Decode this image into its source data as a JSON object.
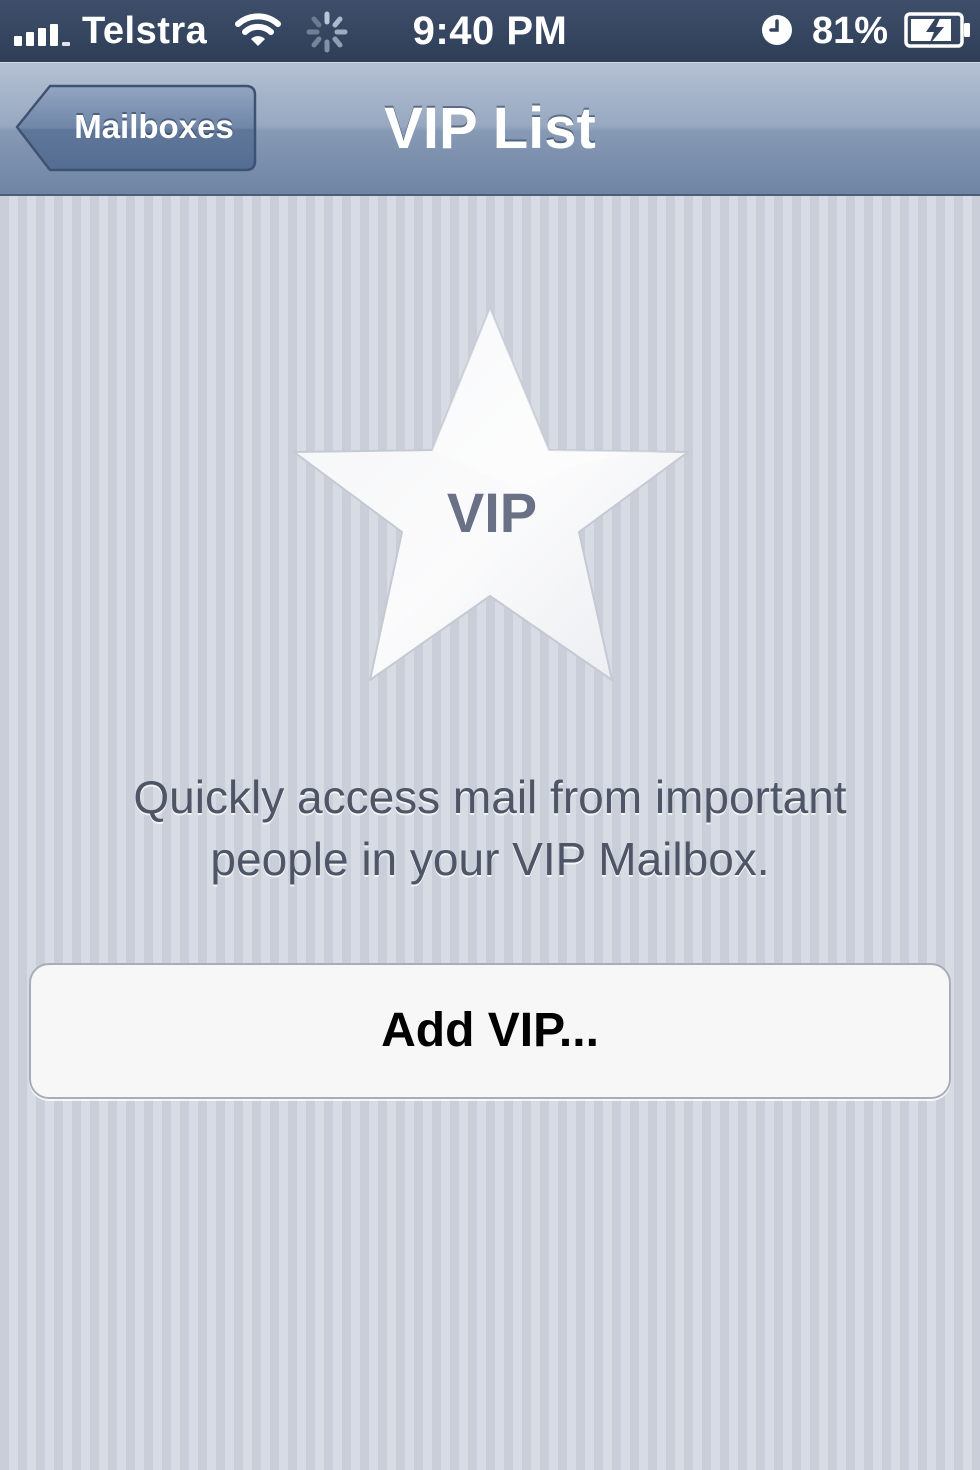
{
  "status_bar": {
    "carrier": "Telstra",
    "time": "9:40 PM",
    "battery_percent": "81%",
    "signal_bars": 4,
    "icons": [
      "signal-icon",
      "wifi-icon",
      "activity-icon",
      "alarm-icon",
      "battery-charging-icon"
    ]
  },
  "nav": {
    "back_label": "Mailboxes",
    "title": "VIP List"
  },
  "content": {
    "star_label": "VIP",
    "description": "Quickly access mail from important people in your VIP Mailbox.",
    "add_button_label": "Add VIP..."
  },
  "colors": {
    "nav_bar": "#8699b5",
    "status_bar": "#2f3e57",
    "background": "#cfd3dc",
    "description_text": "#4d5566",
    "star_text": "#6a7186"
  }
}
